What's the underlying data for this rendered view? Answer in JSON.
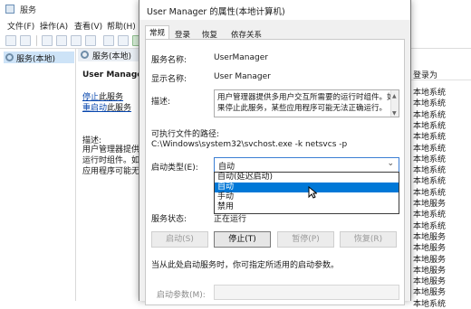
{
  "services_window": {
    "title": "服务",
    "menu": [
      "文件(F)",
      "操作(A)",
      "查看(V)",
      "帮助(H)"
    ],
    "tree_node": "服务(本地)",
    "header": "服务(本地)",
    "detail": {
      "name": "User Manager",
      "stop_link": "停止",
      "stop_rest": "此服务",
      "restart_link": "重启动",
      "restart_rest": "此服务",
      "desc_label": "描述:",
      "desc_lines": [
        "用户管理器提供多",
        "运行时组件。如果",
        "应用程序可能无法"
      ]
    },
    "right_column": {
      "header": "登录为",
      "rows": [
        "本地系统",
        "本地系统",
        "本地系统",
        "本地系统",
        "本地系统",
        "本地系统",
        "本地系统",
        "本地系统",
        "本地系统",
        "本地系统",
        "本地服务",
        "本地系统",
        "本地系统",
        "本地服务",
        "本地服务",
        "本地服务",
        "本地服务",
        "本地服务",
        "本地服务",
        "本地系统"
      ]
    }
  },
  "dialog": {
    "title": "User Manager 的属性(本地计算机)",
    "tabs": [
      "常规",
      "登录",
      "恢复",
      "依存关系"
    ],
    "service_name_label": "服务名称:",
    "service_name": "UserManager",
    "display_name_label": "显示名称:",
    "display_name": "User Manager",
    "description_label": "描述:",
    "description": "用户管理器提供多用户交互所需要的运行时组件。如果停止此服务，某些应用程序可能无法正确运行。",
    "exe_path_label": "可执行文件的路径:",
    "exe_path": "C:\\Windows\\system32\\svchost.exe -k netsvcs -p",
    "startup_type_label": "启动类型(E):",
    "startup_type_value": "自动",
    "startup_options": [
      "自动(延迟启动)",
      "自动",
      "手动",
      "禁用"
    ],
    "selected_option_index": 1,
    "service_status_label": "服务状态:",
    "service_status": "正在运行",
    "buttons": {
      "start": "启动(S)",
      "stop": "停止(T)",
      "pause": "暂停(P)",
      "resume": "恢复(R)"
    },
    "hint": "当从此处启动服务时，你可指定所适用的启动参数。",
    "start_params_label": "启动参数(M):"
  }
}
